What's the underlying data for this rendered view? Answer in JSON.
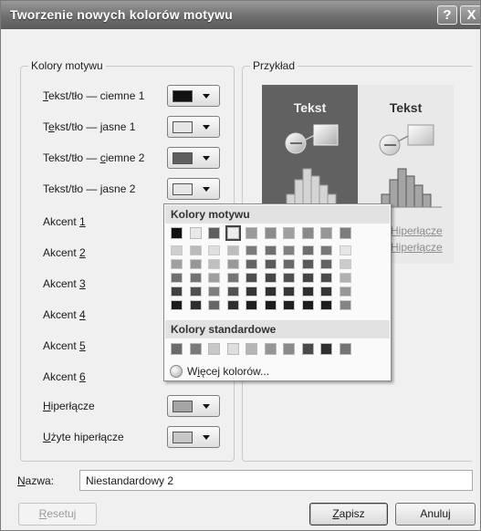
{
  "window": {
    "title": "Tworzenie nowych kolorów motywu",
    "help_glyph": "?",
    "close_glyph": "X"
  },
  "theme_colors": {
    "legend": "Kolory motywu",
    "rows": [
      {
        "pre": "",
        "key": "T",
        "post": "ekst/tło — ciemne 1",
        "swatch": "#111111"
      },
      {
        "pre": "T",
        "key": "e",
        "post": "kst/tło — jasne 1",
        "swatch": "#e6e6e6"
      },
      {
        "pre": "Tekst/tło — ",
        "key": "c",
        "post": "iemne 2",
        "swatch": "#5f5f5f"
      },
      {
        "pre": "Tekst/tło — ",
        "key": "j",
        "post": "asne 2",
        "swatch": "#e6e6e6"
      },
      {
        "pre": "Akcent ",
        "key": "1",
        "post": "",
        "swatch": "#9a9a9a"
      },
      {
        "pre": "Akcent ",
        "key": "2",
        "post": "",
        "swatch": "#8c8c8c"
      },
      {
        "pre": "Akcent ",
        "key": "3",
        "post": "",
        "swatch": "#a0a0a0"
      },
      {
        "pre": "Akcent ",
        "key": "4",
        "post": "",
        "swatch": "#8a8a8a"
      },
      {
        "pre": "Akcent ",
        "key": "5",
        "post": "",
        "swatch": "#969696"
      },
      {
        "pre": "Akcent ",
        "key": "6",
        "post": "",
        "swatch": "#7d7d7d"
      },
      {
        "pre": "",
        "key": "H",
        "post": "iperłącze",
        "swatch": "#a5a5a5"
      },
      {
        "pre": "",
        "key": "U",
        "post": "żyte hiperłącze",
        "swatch": "#c7c7c7"
      }
    ]
  },
  "example": {
    "legend": "Przykład",
    "heading_dark": "Tekst",
    "heading_light": "Tekst",
    "link1": "Hiperłącze",
    "link2": "Hiperłącze"
  },
  "picker": {
    "theme_heading": "Kolory motywu",
    "standard_heading": "Kolory standardowe",
    "more_pre": "W",
    "more_key": "i",
    "more_post": "ęcej kolorów...",
    "theme_colors": [
      "#111111",
      "#e8e8e8",
      "#5f5f5f",
      "#ececec",
      "#9a9a9a",
      "#8c8c8c",
      "#a0a0a0",
      "#8a8a8a",
      "#969696",
      "#7d7d7d"
    ],
    "standard_colors": [
      "#6a6a6a",
      "#7a7a7a",
      "#c8c8c8",
      "#dedede",
      "#b5b5b5",
      "#959595",
      "#8a8a8a",
      "#4a4a4a",
      "#2f2f2f",
      "#747474"
    ]
  },
  "name_field": {
    "label_key": "N",
    "label_rest": "azwa:",
    "value": "Niestandardowy 2"
  },
  "buttons": {
    "reset_key": "R",
    "reset_rest": "esetuj",
    "save_key": "Z",
    "save_rest": "apisz",
    "cancel": "Anuluj"
  }
}
